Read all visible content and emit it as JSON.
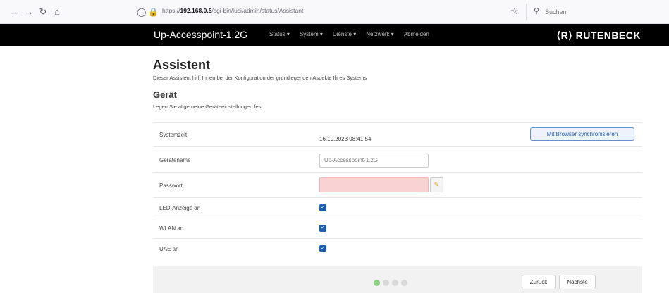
{
  "browser": {
    "url_prefix": "https://",
    "url_host": "192.168.0.5",
    "url_path": "/cgi-bin/luci/admin/status/Assistant",
    "search_placeholder": "Suchen"
  },
  "header": {
    "title": "Up-Accesspoint-1.2G",
    "menu": [
      "Status",
      "System",
      "Dienste",
      "Netzwerk",
      "Abmelden"
    ],
    "brand": "⟨R⟩ RUTENBECK"
  },
  "page": {
    "title": "Assistent",
    "description": "Dieser Assistent hilft Ihnen bei der Konfiguration der grundlegenden Aspekte Ihres Systems",
    "section_title": "Gerät",
    "section_description": "Legen Sie allgemeine Geräteeinstellungen fest"
  },
  "form": {
    "systemzeit_label": "Systemzeit",
    "systemzeit_value": "16.10.2023 08:41:54",
    "sync_button": "Mit Browser synchronisieren",
    "geraetename_label": "Gerätename",
    "geraetename_placeholder": "Up-Accesspoint-1.2G",
    "passwort_label": "Passwort",
    "passwort_value": "",
    "led_label": "LED-Anzeige an",
    "led_checked": true,
    "wlan_label": "WLAN an",
    "wlan_checked": true,
    "uae_label": "UAE an",
    "uae_checked": true
  },
  "footer": {
    "steps_total": 4,
    "current_step": 1,
    "back_button": "Zurück",
    "next_button": "Nächste"
  },
  "colors": {
    "header_bg": "#000000",
    "checkbox": "#1a5fb4",
    "password_invalid": "#f9d3d3",
    "step_active": "#8fcf83"
  }
}
